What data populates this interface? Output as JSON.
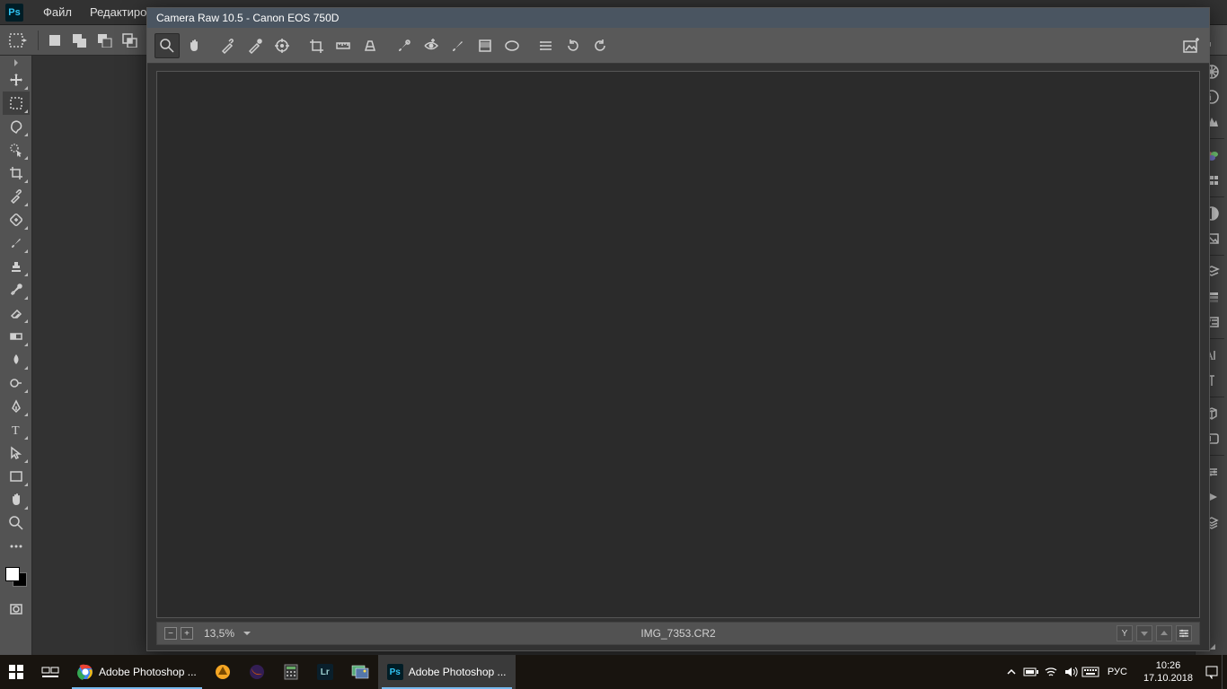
{
  "ps": {
    "menu": {
      "file": "Файл",
      "edit": "Редактирован"
    }
  },
  "cr": {
    "title": "Camera Raw 10.5  -  Canon EOS 750D",
    "zoom": "13,5%",
    "filename": "IMG_7353.CR2",
    "rating_mark": "Y"
  },
  "taskbar": {
    "item1": "Adobe Photoshop ...",
    "item2": "Adobe Photoshop ...",
    "lang": "РУС",
    "time": "10:26",
    "date": "17.10.2018"
  }
}
